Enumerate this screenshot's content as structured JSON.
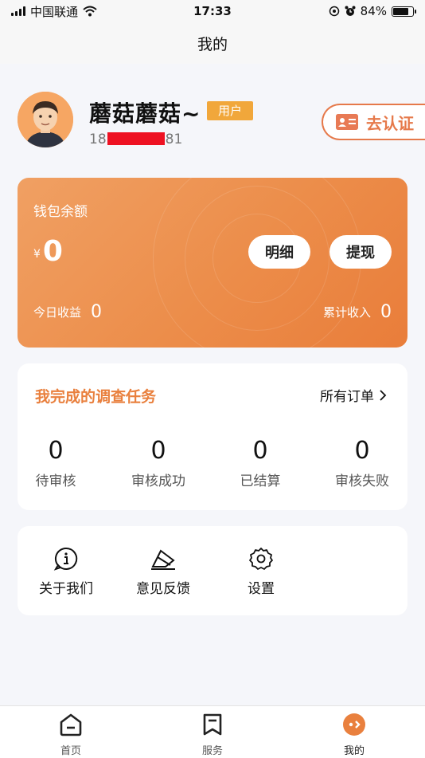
{
  "status_bar": {
    "carrier": "中国联通",
    "time": "17:33",
    "battery": "84%",
    "battery_level": 0.84
  },
  "nav": {
    "title": "我的"
  },
  "profile": {
    "username": "蘑菇蘑菇~",
    "role": "用户",
    "phone_prefix": "18",
    "phone_suffix": "81",
    "verify_label": "去认证"
  },
  "wallet": {
    "title": "钱包余额",
    "currency": "¥",
    "balance": "0",
    "detail_label": "明细",
    "withdraw_label": "提现",
    "today_label": "今日收益",
    "today_value": "0",
    "total_label": "累计收入",
    "total_value": "0"
  },
  "tasks": {
    "title": "我完成的调查任务",
    "all_orders_label": "所有订单",
    "stats": [
      {
        "value": "0",
        "label": "待审核"
      },
      {
        "value": "0",
        "label": "审核成功"
      },
      {
        "value": "0",
        "label": "已结算"
      },
      {
        "value": "0",
        "label": "审核失败"
      }
    ]
  },
  "menu": {
    "items": [
      {
        "label": "关于我们",
        "icon": "info-icon"
      },
      {
        "label": "意见反馈",
        "icon": "feedback-icon"
      },
      {
        "label": "设置",
        "icon": "gear-icon"
      }
    ]
  },
  "tab_bar": {
    "items": [
      {
        "label": "首页",
        "icon": "home-icon"
      },
      {
        "label": "服务",
        "icon": "bookmark-icon"
      },
      {
        "label": "我的",
        "icon": "profile-icon"
      }
    ],
    "active_color": "#e9803e"
  },
  "colors": {
    "accent": "#e9803e",
    "badge": "#f1a73b"
  }
}
